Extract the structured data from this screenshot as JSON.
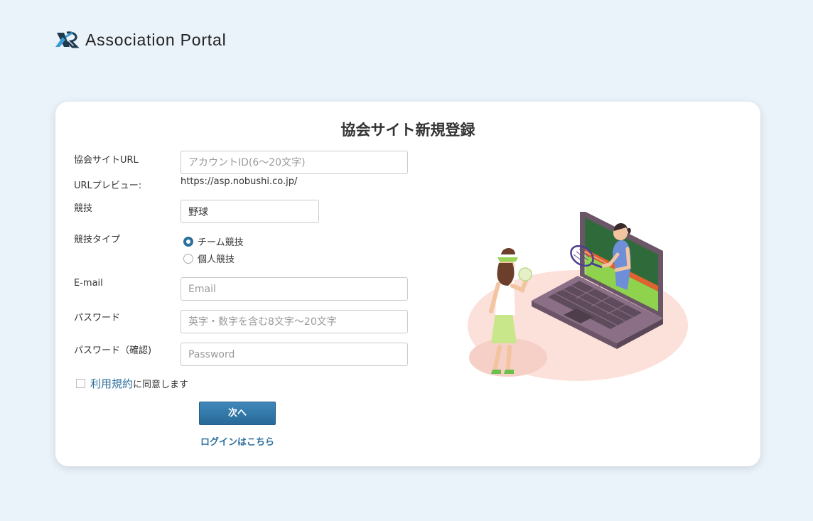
{
  "header": {
    "app_title": "Association Portal",
    "logo_icon": "association-portal-logo"
  },
  "form": {
    "title": "協会サイト新規登録",
    "site_url_label": "協会サイトURL",
    "site_url_placeholder": "アカウントID(6〜20文字)",
    "url_preview_label": "URLプレビュー:",
    "url_preview_value": "https://asp.nobushi.co.jp/",
    "sport_label": "競技",
    "sport_value": "野球",
    "sport_type_label": "競技タイプ",
    "sport_type_options": [
      {
        "label": "チーム競技",
        "selected": true
      },
      {
        "label": "個人競技",
        "selected": false
      }
    ],
    "email_label": "E-mail",
    "email_placeholder": "Email",
    "password_label": "パスワード",
    "password_placeholder": "英字・数字を含む8文字〜20文字",
    "password_confirm_label": "パスワード（確認)",
    "password_confirm_placeholder": "Password",
    "terms_link": "利用規約",
    "terms_text": "に同意します",
    "terms_checked": false,
    "next_button": "次へ",
    "login_link": "ログインはこちら"
  },
  "colors": {
    "accent": "#2d6f9c",
    "background": "#eaf2fa"
  }
}
